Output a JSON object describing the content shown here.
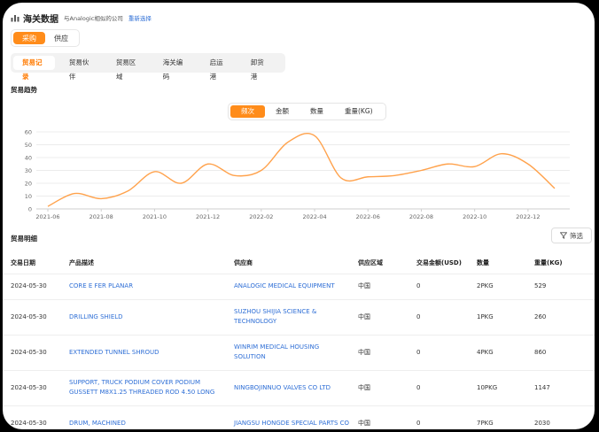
{
  "header": {
    "title": "海关数据",
    "subtitle": "与Analogic相似的公司",
    "reselect": "重新选择",
    "icon": "bar-chart-icon"
  },
  "mode_toggle": [
    {
      "label": "采购",
      "active": true
    },
    {
      "label": "供应",
      "active": false
    }
  ],
  "tabs": [
    {
      "label": "贸易记录",
      "active": true
    },
    {
      "label": "贸易伙伴",
      "active": false
    },
    {
      "label": "贸易区域",
      "active": false
    },
    {
      "label": "海关编码",
      "active": false
    },
    {
      "label": "启运港",
      "active": false
    },
    {
      "label": "卸货港",
      "active": false
    }
  ],
  "trend": {
    "title": "贸易趋势",
    "metrics": [
      {
        "label": "频次",
        "active": true
      },
      {
        "label": "金额",
        "active": false
      },
      {
        "label": "数量",
        "active": false
      },
      {
        "label": "重量(KG)",
        "active": false
      }
    ]
  },
  "chart_data": {
    "type": "line",
    "series_color": "#ffa24c",
    "y_ticks": [
      "0",
      "10",
      "20",
      "30",
      "40",
      "50",
      "60"
    ],
    "ylim": [
      0,
      60
    ],
    "x_tick_labels": [
      "2021-06",
      "2021-08",
      "2021-10",
      "2021-12",
      "2022-02",
      "2022-04",
      "2022-06",
      "2022-08",
      "2022-10",
      "2022-12"
    ],
    "x": [
      "2021-06",
      "2021-07",
      "2021-08",
      "2021-09",
      "2021-10",
      "2021-11",
      "2021-12",
      "2022-01",
      "2022-02",
      "2022-03",
      "2022-04",
      "2022-05",
      "2022-06",
      "2022-07",
      "2022-08",
      "2022-09",
      "2022-10",
      "2022-11",
      "2022-12",
      "2023-01"
    ],
    "values": [
      2,
      12,
      8,
      14,
      29,
      20,
      35,
      26,
      30,
      52,
      57,
      24,
      25,
      26,
      30,
      35,
      33,
      43,
      35,
      16
    ]
  },
  "details": {
    "title": "贸易明细",
    "filter_label": "筛选"
  },
  "table": {
    "columns": [
      "交易日期",
      "产品描述",
      "供应商",
      "供应区域",
      "交易金额(USD)",
      "数量",
      "重量(KG)"
    ],
    "rows": [
      [
        "2024-05-30",
        "CORE E FER PLANAR",
        "ANALOGIC MEDICAL EQUIPMENT",
        "中国",
        "0",
        "2PKG",
        "529"
      ],
      [
        "2024-05-30",
        "DRILLING SHIELD",
        "SUZHOU SHIJIA SCIENCE & TECHNOLOGY",
        "中国",
        "0",
        "1PKG",
        "260"
      ],
      [
        "2024-05-30",
        "EXTENDED TUNNEL SHROUD",
        "WINRIM MEDICAL HOUSING SOLUTION",
        "中国",
        "0",
        "4PKG",
        "860"
      ],
      [
        "2024-05-30",
        "SUPPORT, TRUCK PODIUM COVER PODIUM GUSSETT M8X1.25 THREADED ROD 4.50 LONG",
        "NINGBOJINNUO VALVES CO LTD",
        "中国",
        "0",
        "10PKG",
        "1147"
      ],
      [
        "2024-05-30",
        "DRUM, MACHINED",
        "JIANGSU HONGDE SPECIAL PARTS CO",
        "中国",
        "0",
        "7PKG",
        "2030"
      ]
    ]
  }
}
